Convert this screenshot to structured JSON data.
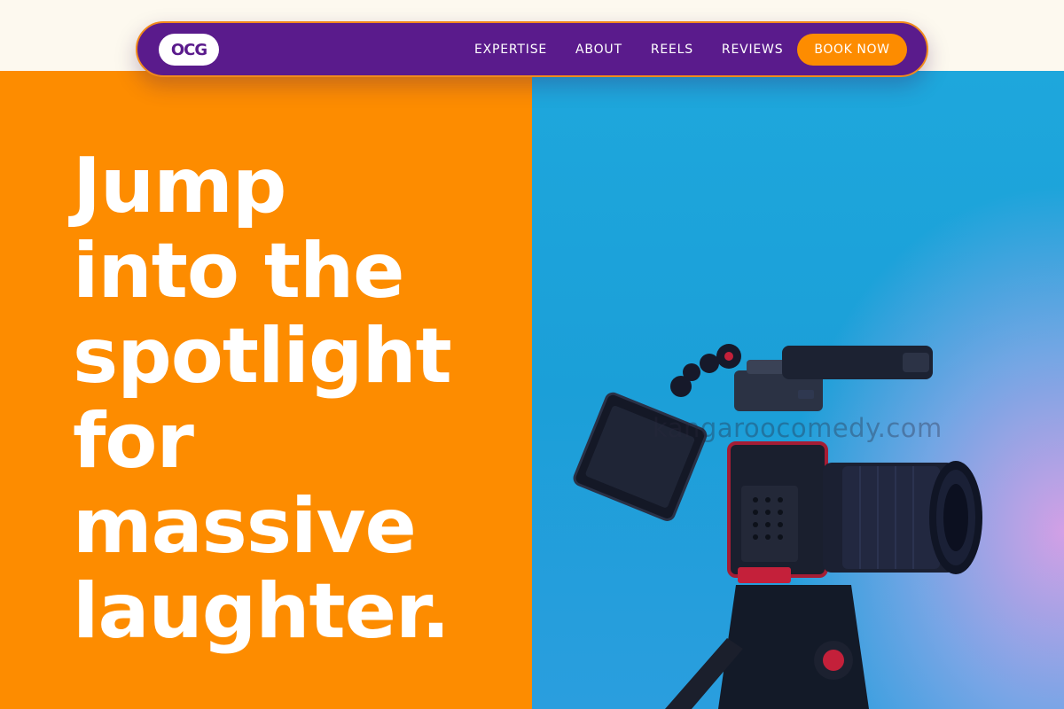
{
  "brand": {
    "logo_text": "OCG"
  },
  "nav": {
    "items": [
      {
        "label": "EXPERTISE"
      },
      {
        "label": "ABOUT"
      },
      {
        "label": "REELS"
      },
      {
        "label": "REVIEWS"
      }
    ],
    "cta_label": "BOOK NOW"
  },
  "hero": {
    "headline_lines": [
      "Jump",
      "into the",
      "spotlight",
      "for",
      "massive",
      "laughter."
    ],
    "image": {
      "icon": "camera-on-tripod",
      "watermark": "kangaroocomedy.com"
    }
  },
  "colors": {
    "nav_background": "#5a1b8c",
    "accent_orange": "#fd8c00",
    "page_cream": "#fdf9ef",
    "photo_blue": "#1ea7dc"
  }
}
